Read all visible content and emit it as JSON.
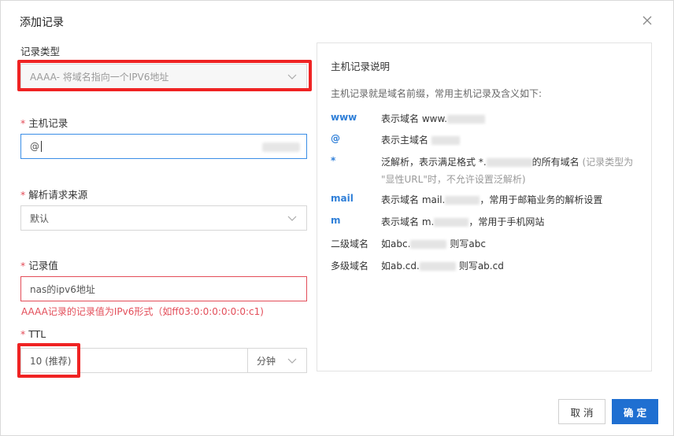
{
  "dialog": {
    "title": "添加记录",
    "close_label": "×"
  },
  "form": {
    "record_type": {
      "label": "记录类型",
      "value": "AAAA- 将域名指向一个IPV6地址"
    },
    "host_record": {
      "label": "主机记录",
      "value": "@"
    },
    "resolve_source": {
      "label": "解析请求来源",
      "value": "默认"
    },
    "record_value": {
      "label": "记录值",
      "value": "nas的ipv6地址",
      "error": "AAAA记录的记录值为IPv6形式（如ff03:0:0:0:0:0:0:c1)"
    },
    "ttl": {
      "label": "TTL",
      "value": "10 (推荐)",
      "unit": "分钟"
    },
    "required_mark": "*"
  },
  "help_panel": {
    "title": "主机记录说明",
    "intro": "主机记录就是域名前缀，常用主机记录及含义如下:",
    "rows": [
      {
        "key": "www",
        "desc": "表示域名 www."
      },
      {
        "key": "@",
        "desc": "表示主域名 "
      },
      {
        "key": "*",
        "desc": "泛解析，表示满足格式 *.",
        "desc_after": "的所有域名",
        "muted": "(记录类型为",
        "line2": "\"显性URL\"时，不允许设置泛解析)"
      },
      {
        "key": "mail",
        "desc": "表示域名 mail.",
        "desc_after": "，常用于邮箱业务的解析设置"
      },
      {
        "key": "m",
        "desc": "表示域名 m.",
        "desc_after": "，常用于手机网站"
      },
      {
        "key": "二级域名",
        "desc": "如abc.",
        "desc_after": "则写abc"
      },
      {
        "key": "多级域名",
        "desc": "如ab.cd.",
        "desc_after": "则写ab.cd"
      }
    ]
  },
  "buttons": {
    "cancel": "取 消",
    "ok": "确 定"
  },
  "colors": {
    "primary": "#1f6fd1",
    "error": "#e34d59",
    "highlight_box": "#ef2323",
    "key_blue": "#2f7fd8"
  },
  "icons": {
    "close": "close-icon",
    "chevron": "chevron-down-icon"
  }
}
